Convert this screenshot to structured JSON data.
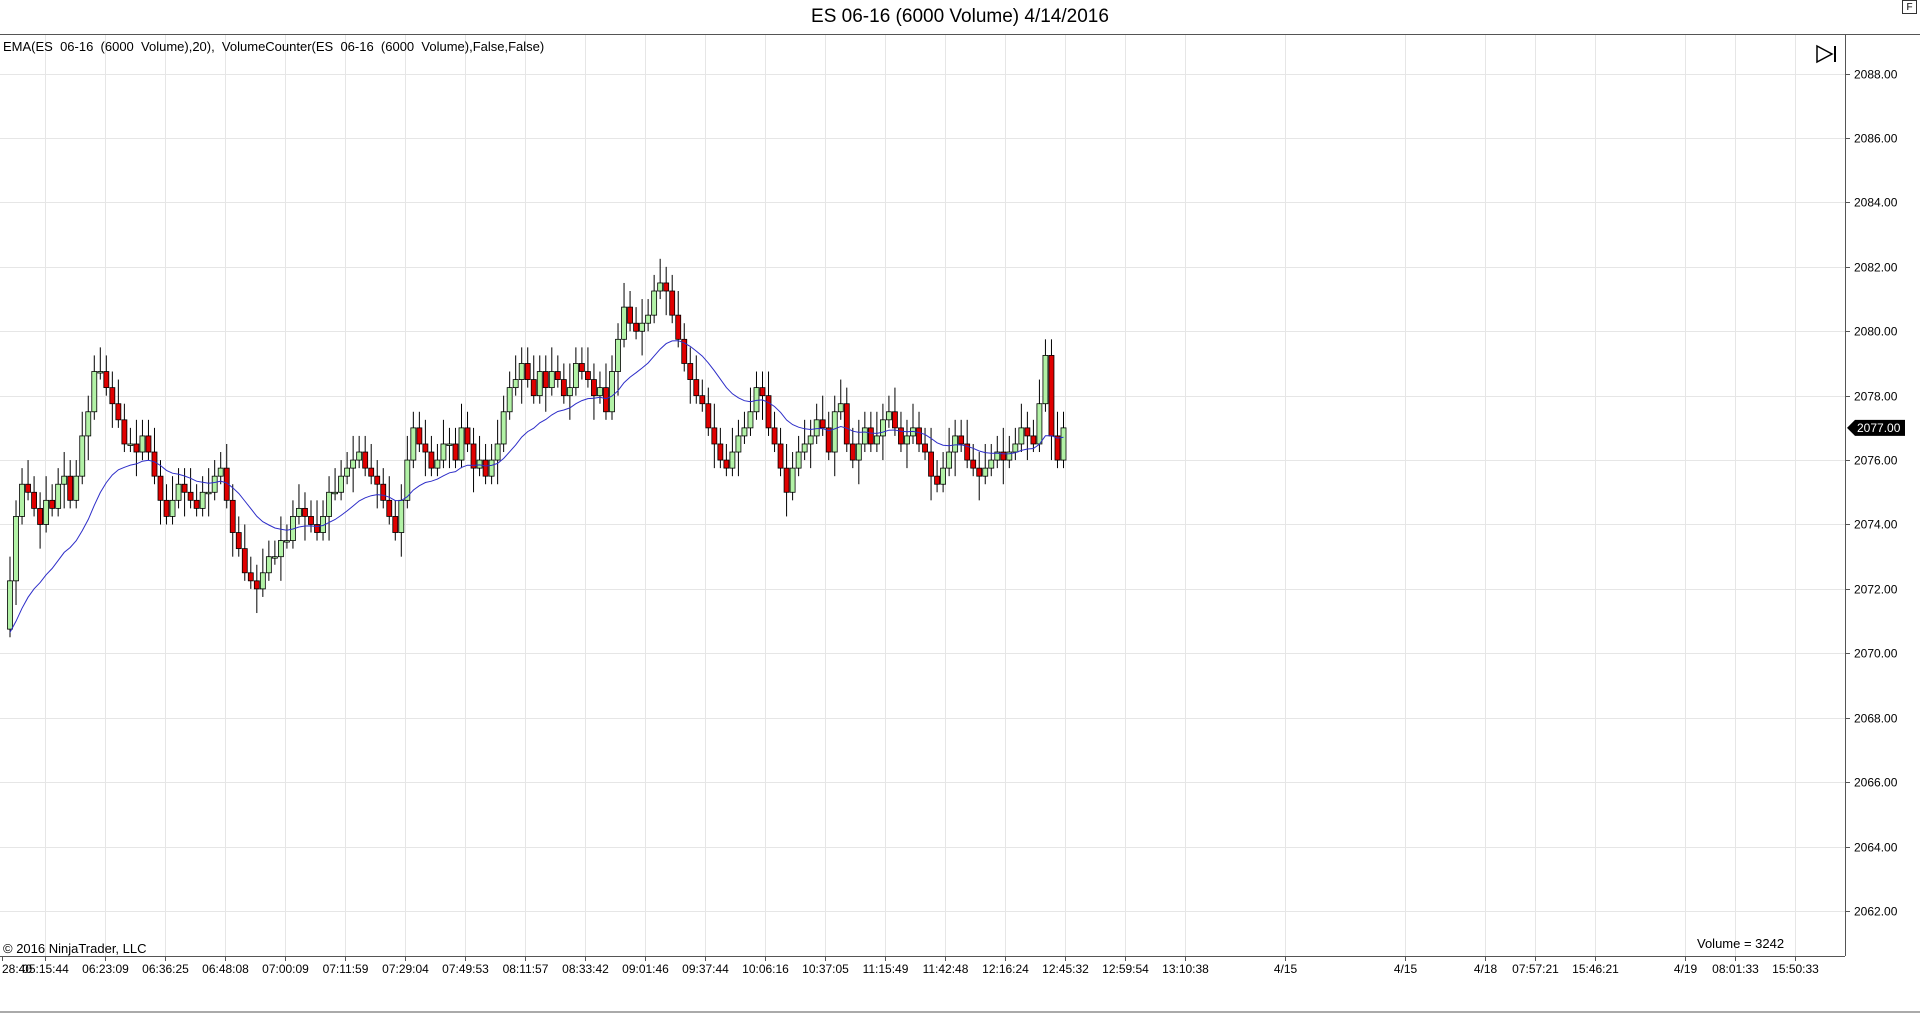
{
  "window": {
    "title": "ES 06-16 (6000 Volume)  4/14/2016",
    "indicator_label": "EMA(ES  06-16  (6000  Volume),20),  VolumeCounter(ES  06-16  (6000  Volume),False,False)",
    "copyright": "© 2016 NinjaTrader, LLC",
    "volume_label": "Volume = 3242",
    "f_button": "F",
    "current_price": "2077.00"
  },
  "colors": {
    "up_candle": "#b2f2a6",
    "down_candle": "#e00000",
    "wick": "#000000",
    "ema_line": "#2d2dc8",
    "grid": "#e6e6e6",
    "price_tag_bg": "#000000",
    "price_tag_text": "#ffffff"
  },
  "icons": {
    "scroll_end": "skip-to-end-icon"
  },
  "chart_data": {
    "type": "candlestick",
    "symbol": "ES 06-16",
    "interval": "6000 Volume",
    "y_axis": {
      "range": [
        2060.6,
        2089.2
      ],
      "ticks": [
        "2088.00",
        "2086.00",
        "2084.00",
        "2082.00",
        "2080.00",
        "2078.00",
        "2076.00",
        "2074.00",
        "2072.00",
        "2070.00",
        "2068.00",
        "2066.00",
        "2064.00",
        "2062.00"
      ]
    },
    "x_axis": {
      "ticks": [
        "28:40",
        "05:15:44",
        "06:23:09",
        "06:36:25",
        "06:48:08",
        "07:00:09",
        "07:11:59",
        "07:29:04",
        "07:49:53",
        "08:11:57",
        "08:33:42",
        "09:01:46",
        "09:37:44",
        "10:06:16",
        "10:37:05",
        "11:15:49",
        "11:42:48",
        "12:16:24",
        "12:45:32",
        "12:59:54",
        "13:10:38",
        "4/15",
        "4/15",
        "4/18",
        "07:57:21",
        "15:46:21",
        "4/19",
        "08:01:33",
        "15:50:33"
      ]
    },
    "closes": [
      2072.25,
      2074.25,
      2075.25,
      2075.0,
      2074.5,
      2074.0,
      2074.75,
      2074.5,
      2075.25,
      2075.5,
      2074.75,
      2075.5,
      2076.75,
      2077.5,
      2078.75,
      2078.75,
      2078.25,
      2077.75,
      2077.25,
      2076.5,
      2076.5,
      2076.25,
      2076.75,
      2076.25,
      2075.5,
      2074.75,
      2074.25,
      2074.75,
      2075.25,
      2075.0,
      2074.75,
      2074.5,
      2075.0,
      2075.0,
      2075.5,
      2075.75,
      2074.75,
      2073.75,
      2073.25,
      2072.5,
      2072.25,
      2072.0,
      2072.5,
      2073.0,
      2073.0,
      2073.5,
      2073.5,
      2074.25,
      2074.5,
      2074.25,
      2074.0,
      2073.75,
      2074.25,
      2075.0,
      2075.0,
      2075.5,
      2075.75,
      2076.0,
      2076.25,
      2075.75,
      2075.5,
      2075.25,
      2074.75,
      2074.25,
      2073.75,
      2074.75,
      2076.0,
      2077.0,
      2076.5,
      2076.25,
      2075.75,
      2076.0,
      2076.5,
      2076.5,
      2076.0,
      2077.0,
      2076.5,
      2075.75,
      2076.0,
      2075.5,
      2076.0,
      2076.5,
      2077.5,
      2078.25,
      2078.5,
      2079.0,
      2078.5,
      2078.0,
      2078.75,
      2078.25,
      2078.75,
      2078.5,
      2078.0,
      2078.25,
      2079.0,
      2078.75,
      2078.5,
      2078.0,
      2078.25,
      2077.5,
      2078.75,
      2079.75,
      2080.75,
      2080.25,
      2080.0,
      2080.25,
      2080.5,
      2081.25,
      2081.5,
      2081.25,
      2080.5,
      2079.75,
      2079.0,
      2078.5,
      2078.0,
      2077.75,
      2077.0,
      2076.5,
      2076.0,
      2075.75,
      2076.25,
      2076.75,
      2077.0,
      2077.5,
      2078.25,
      2078.0,
      2077.0,
      2076.5,
      2075.75,
      2075.0,
      2075.75,
      2076.25,
      2076.5,
      2076.75,
      2077.25,
      2077.0,
      2076.25,
      2077.5,
      2077.75,
      2076.5,
      2076.0,
      2076.5,
      2077.0,
      2076.5,
      2076.75,
      2077.25,
      2077.5,
      2077.0,
      2076.5,
      2076.75,
      2077.0,
      2076.5,
      2076.25,
      2075.5,
      2075.25,
      2075.75,
      2076.25,
      2076.75,
      2076.5,
      2076.0,
      2075.75,
      2075.5,
      2075.75,
      2076.0,
      2076.25,
      2076.0,
      2076.25,
      2076.5,
      2077.0,
      2076.75,
      2076.5,
      2077.75,
      2079.25,
      2076.75,
      2076.0,
      2077.0
    ]
  }
}
